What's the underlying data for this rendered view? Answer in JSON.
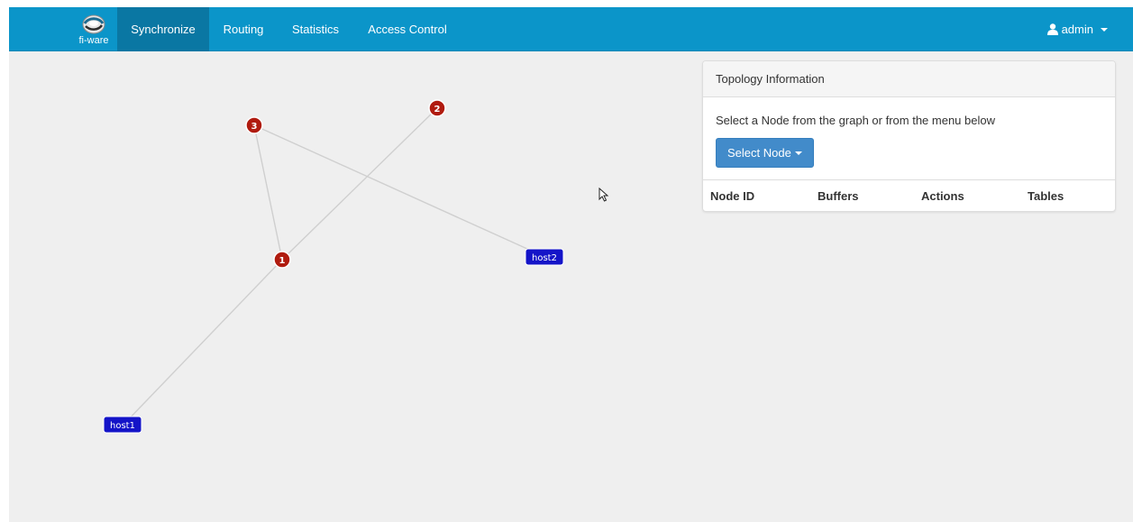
{
  "navbar": {
    "brand_text": "fi-ware",
    "items": [
      {
        "label": "Synchronize",
        "active": true
      },
      {
        "label": "Routing",
        "active": false
      },
      {
        "label": "Statistics",
        "active": false
      },
      {
        "label": "Access Control",
        "active": false
      }
    ],
    "user": {
      "label": "admin",
      "icon": "user-icon"
    }
  },
  "graph": {
    "switches": [
      {
        "id": "1",
        "label": "1"
      },
      {
        "id": "2",
        "label": "2"
      },
      {
        "id": "3",
        "label": "3"
      }
    ],
    "hosts": [
      {
        "id": "host1",
        "label": "host1"
      },
      {
        "id": "host2",
        "label": "host2"
      }
    ],
    "links": [
      [
        "3",
        "1"
      ],
      [
        "3",
        "host2"
      ],
      [
        "2",
        "1"
      ],
      [
        "1",
        "host1"
      ]
    ]
  },
  "panel": {
    "title": "Topology Information",
    "description": "Select a Node from the graph or from the menu below",
    "select_button": "Select Node",
    "columns": [
      "Node ID",
      "Buffers",
      "Actions",
      "Tables"
    ]
  },
  "colors": {
    "navbar": "#0b95c9",
    "navbar_active": "#0a77a3",
    "switch_node": "#b01b0f",
    "host_node": "#1414c8",
    "link": "#cfcfcf",
    "button": "#428bca"
  }
}
